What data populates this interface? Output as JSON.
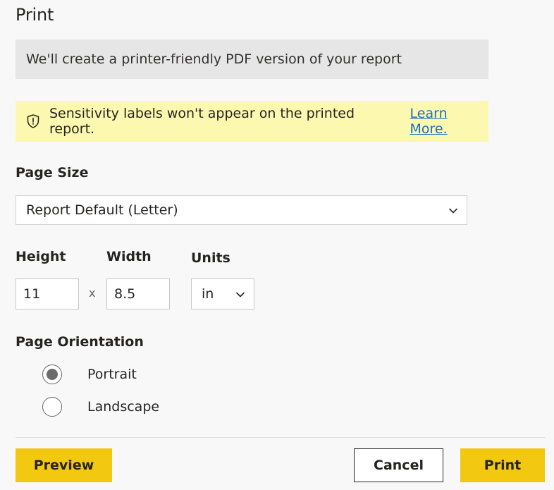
{
  "dialog": {
    "title": "Print",
    "info_text": "We'll create a printer-friendly PDF version of your report",
    "warning": {
      "icon": "shield-icon",
      "text": "Sensitivity labels won't appear on the printed report.",
      "link_label": "Learn More."
    }
  },
  "page_size": {
    "label": "Page Size",
    "selected": "Report Default (Letter)"
  },
  "dimensions": {
    "height_label": "Height",
    "width_label": "Width",
    "units_label": "Units",
    "height_value": "11",
    "separator": "x",
    "width_value": "8.5",
    "units_selected": "in"
  },
  "orientation": {
    "label": "Page Orientation",
    "options": [
      {
        "label": "Portrait",
        "selected": true
      },
      {
        "label": "Landscape",
        "selected": false
      }
    ]
  },
  "buttons": {
    "preview_label": "Preview",
    "cancel_label": "Cancel",
    "print_label": "Print"
  },
  "colors": {
    "accent": "#f2c811",
    "warning_bg": "#fcf8b0",
    "link": "#1a6fbf"
  }
}
